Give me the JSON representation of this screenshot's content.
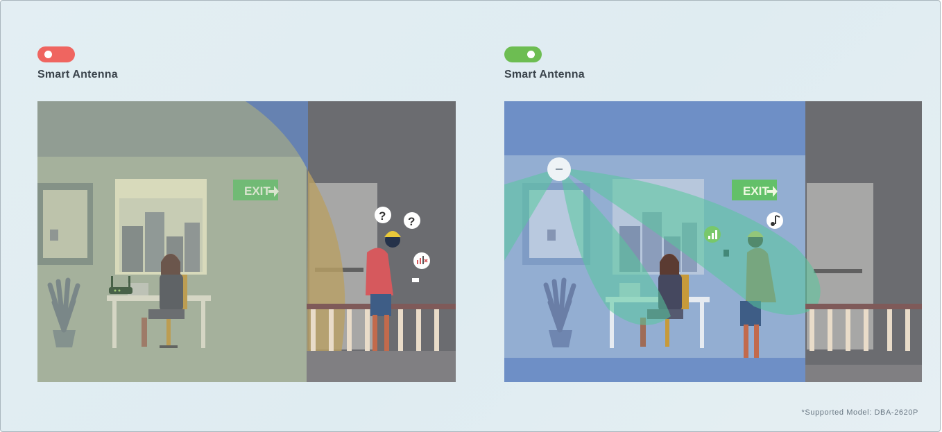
{
  "colors": {
    "toggle_off": "#ef6560",
    "toggle_on": "#6dbd52",
    "title_text": "#3a434b",
    "footnote_text": "#6a7884"
  },
  "left_panel": {
    "toggle_state": "off",
    "title": "Smart Antenna",
    "scene": {
      "exit_sign": "EXIT",
      "icons": [
        "question-bubble-icon",
        "question-bubble-icon",
        "weak-signal-bubble-icon",
        "router-icon"
      ]
    }
  },
  "right_panel": {
    "toggle_state": "on",
    "title": "Smart Antenna",
    "scene": {
      "exit_sign": "EXIT",
      "icons": [
        "ceiling-access-point-icon",
        "signal-bars-bubble-icon",
        "music-note-bubble-icon"
      ]
    }
  },
  "footnote": "*Supported Model: DBA-2620P"
}
